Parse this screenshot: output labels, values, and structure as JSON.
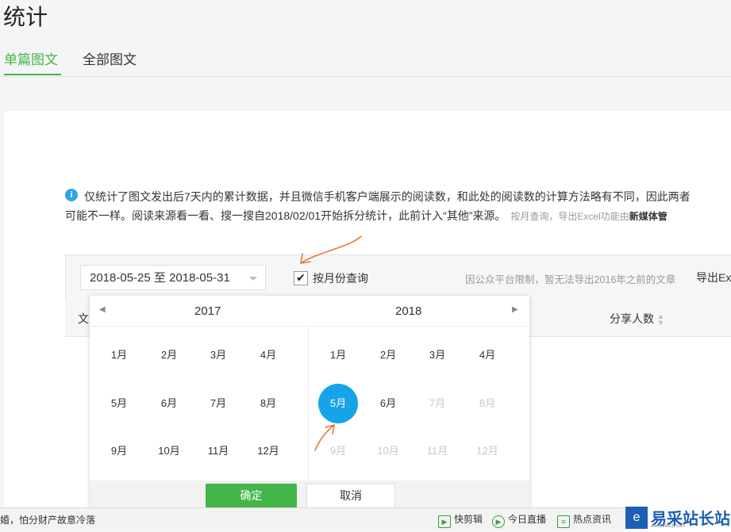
{
  "page": {
    "title": "统计"
  },
  "tabs": [
    {
      "label": "单篇图文",
      "active": true
    },
    {
      "label": "全部图文",
      "active": false
    }
  ],
  "notice": {
    "icon": "info-icon",
    "line1": "仅统计了图文发出后7天内的累计数据，并且微信手机客户端展示的阅读数，和此处的阅读数的计算方法略有不同，因此两者",
    "line2": "可能不一样。阅读来源看一看、搜一搜自2018/02/01开始拆分统计，此前计入“其他”来源。",
    "hint": "按月查询，导出Excel功能由",
    "hint_bold": "新媒体管"
  },
  "toolbar": {
    "date_range": "2018-05-25 至 2018-05-31",
    "monthly_checkbox_checked": true,
    "monthly_checkbox_label": "按月份查询",
    "limit_note": "因公众平台限制，暂无法导出2016年之前的文章",
    "export_label": "导出Ex"
  },
  "table_header": {
    "col_first": "文",
    "col_share": "分享人数"
  },
  "picker": {
    "left_year": "2017",
    "right_year": "2018",
    "left_months": [
      "1月",
      "2月",
      "3月",
      "4月",
      "5月",
      "6月",
      "7月",
      "8月",
      "9月",
      "10月",
      "11月",
      "12月"
    ],
    "right_months": [
      "1月",
      "2月",
      "3月",
      "4月",
      "5月",
      "6月",
      "7月",
      "8月",
      "9月",
      "10月",
      "11月",
      "12月"
    ],
    "right_disabled_from_index": 6,
    "right_selected_index": 4,
    "confirm_label": "确定",
    "cancel_label": "取消"
  },
  "taskbar": {
    "news": "婚，怕分财产故意冷落",
    "items": [
      {
        "icon": "scissors-icon",
        "label": "快剪辑"
      },
      {
        "icon": "play-icon",
        "label": "今日直播"
      },
      {
        "icon": "news-icon",
        "label": "热点资讯"
      }
    ],
    "brand": "易采站长站",
    "brand_url": "www.easck.com"
  },
  "colors": {
    "accent_green": "#44b549",
    "selected_blue": "#17a3e8",
    "annotation_orange": "#e2793a"
  }
}
